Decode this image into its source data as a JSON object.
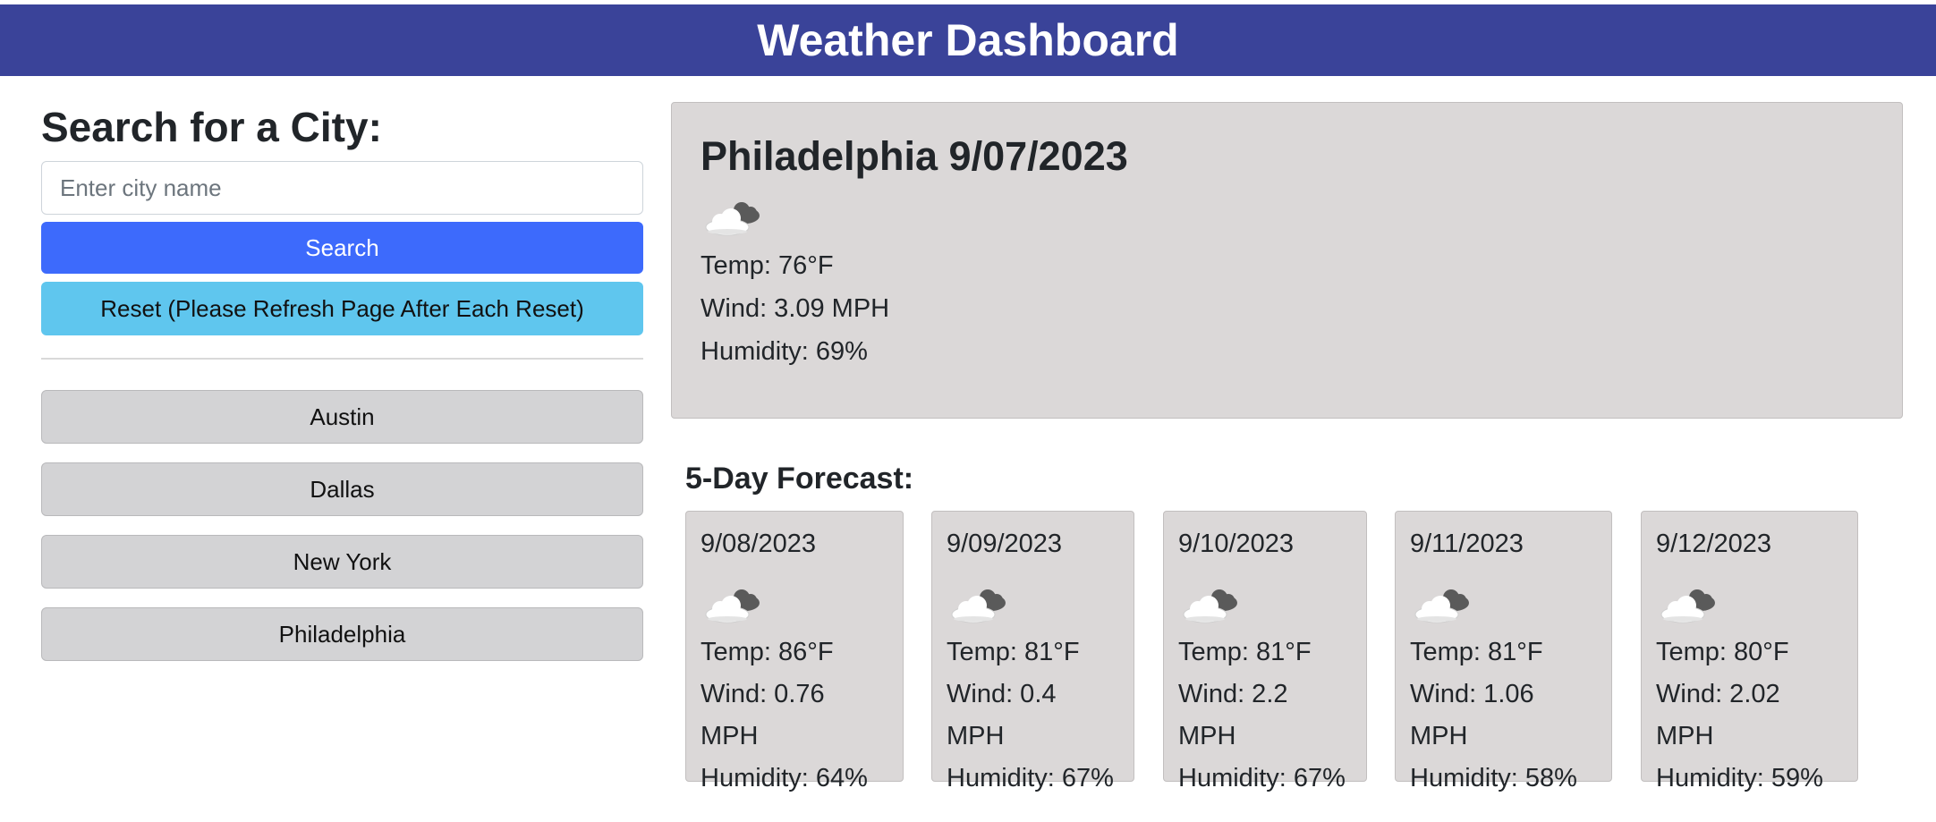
{
  "header": {
    "title": "Weather Dashboard"
  },
  "search": {
    "heading": "Search for a City:",
    "placeholder": "Enter city name",
    "search_label": "Search",
    "reset_label": "Reset (Please Refresh Page After Each Reset)"
  },
  "history": [
    "Austin",
    "Dallas",
    "New York",
    "Philadelphia"
  ],
  "current": {
    "title": "Philadelphia 9/07/2023",
    "icon": "cloud-icon",
    "temp": "Temp: 76°F",
    "wind": "Wind: 3.09 MPH",
    "humidity": "Humidity: 69%"
  },
  "forecast": {
    "title": "5-Day Forecast:",
    "days": [
      {
        "date": "9/08/2023",
        "icon": "cloud-icon",
        "temp": "Temp: 86°F",
        "wind": "Wind: 0.76 MPH",
        "humidity": "Humidity: 64%"
      },
      {
        "date": "9/09/2023",
        "icon": "cloud-icon",
        "temp": "Temp: 81°F",
        "wind": "Wind: 0.4 MPH",
        "humidity": "Humidity: 67%"
      },
      {
        "date": "9/10/2023",
        "icon": "cloud-icon",
        "temp": "Temp: 81°F",
        "wind": "Wind: 2.2 MPH",
        "humidity": "Humidity: 67%"
      },
      {
        "date": "9/11/2023",
        "icon": "cloud-icon",
        "temp": "Temp: 81°F",
        "wind": "Wind: 1.06 MPH",
        "humidity": "Humidity: 58%"
      },
      {
        "date": "9/12/2023",
        "icon": "cloud-icon",
        "temp": "Temp: 80°F",
        "wind": "Wind: 2.02 MPH",
        "humidity": "Humidity: 59%"
      }
    ]
  },
  "colors": {
    "header": "#3a4399",
    "search_button": "#3d6afc",
    "reset_button": "#5fc6ee",
    "panel": "#dbd8d8"
  }
}
